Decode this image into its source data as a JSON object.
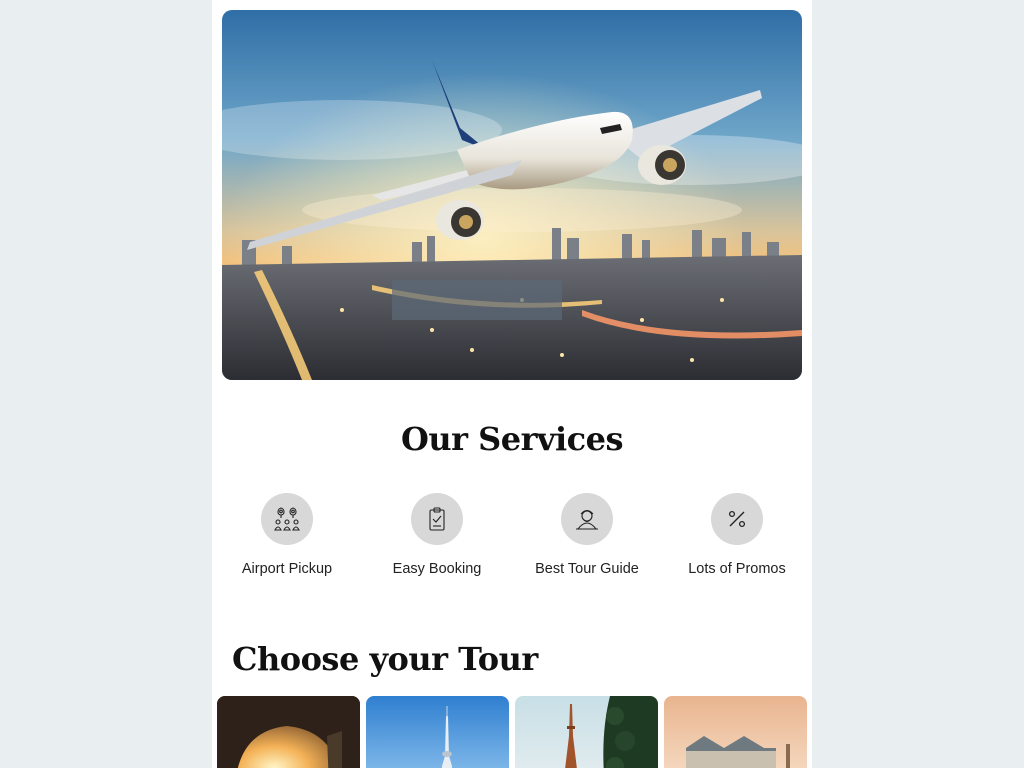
{
  "hero": {
    "image": "airplane-flying-over-city-at-dusk"
  },
  "services": {
    "title": "Our Services",
    "items": [
      {
        "label": "Airport Pickup",
        "icon": "map-pins-people-icon"
      },
      {
        "label": "Easy Booking",
        "icon": "clipboard-check-icon"
      },
      {
        "label": "Best Tour Guide",
        "icon": "tour-guide-icon"
      },
      {
        "label": "Lots of Promos",
        "icon": "percent-icon"
      }
    ]
  },
  "tours": {
    "title": "Choose your Tour",
    "cards": [
      {
        "image": "sunset-archway-photo"
      },
      {
        "image": "tower-blue-sky-photo"
      },
      {
        "image": "eiffel-tower-photo"
      },
      {
        "image": "chateau-sunset-photo"
      }
    ]
  },
  "colors": {
    "page_bg": "#e9eff0",
    "content_bg": "#ffffff",
    "icon_circle": "#d8d8d8"
  }
}
